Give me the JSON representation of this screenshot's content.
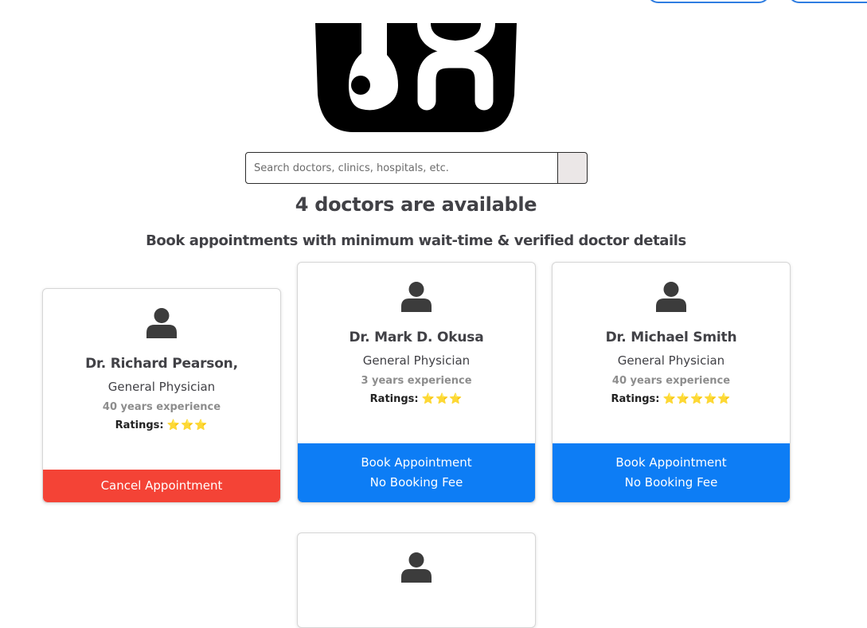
{
  "search": {
    "placeholder": "Search doctors, clinics, hospitals, etc."
  },
  "heading": {
    "count_text": "4 doctors are available",
    "subtitle": "Book appointments with minimum wait-time & verified doctor details"
  },
  "ratings_label": "Ratings:",
  "doctors": [
    {
      "name": "Dr. Richard Pearson,",
      "specialty": "General Physician",
      "experience": "40 years experience",
      "stars": "⭐⭐⭐",
      "rating": 3,
      "action": {
        "type": "cancel",
        "line1": "Cancel Appointment"
      }
    },
    {
      "name": "Dr. Mark D. Okusa",
      "specialty": "General Physician",
      "experience": "3 years experience",
      "stars": "⭐⭐⭐",
      "rating": 3,
      "action": {
        "type": "book",
        "line1": "Book Appointment",
        "line2": "No Booking Fee"
      }
    },
    {
      "name": "Dr. Michael Smith",
      "specialty": "General Physician",
      "experience": "40 years experience",
      "stars": "⭐⭐⭐⭐⭐",
      "rating": 5,
      "action": {
        "type": "book",
        "line1": "Book Appointment",
        "line2": "No Booking Fee"
      }
    }
  ],
  "icons": {
    "logo": "stethoscope-logo-icon",
    "avatar": "user-avatar-icon",
    "star": "star-icon"
  },
  "colors": {
    "book": "#0d7df5",
    "cancel": "#f44336",
    "pill_border": "#2f7de1",
    "star": "#f4c01e",
    "text": "#414146"
  }
}
